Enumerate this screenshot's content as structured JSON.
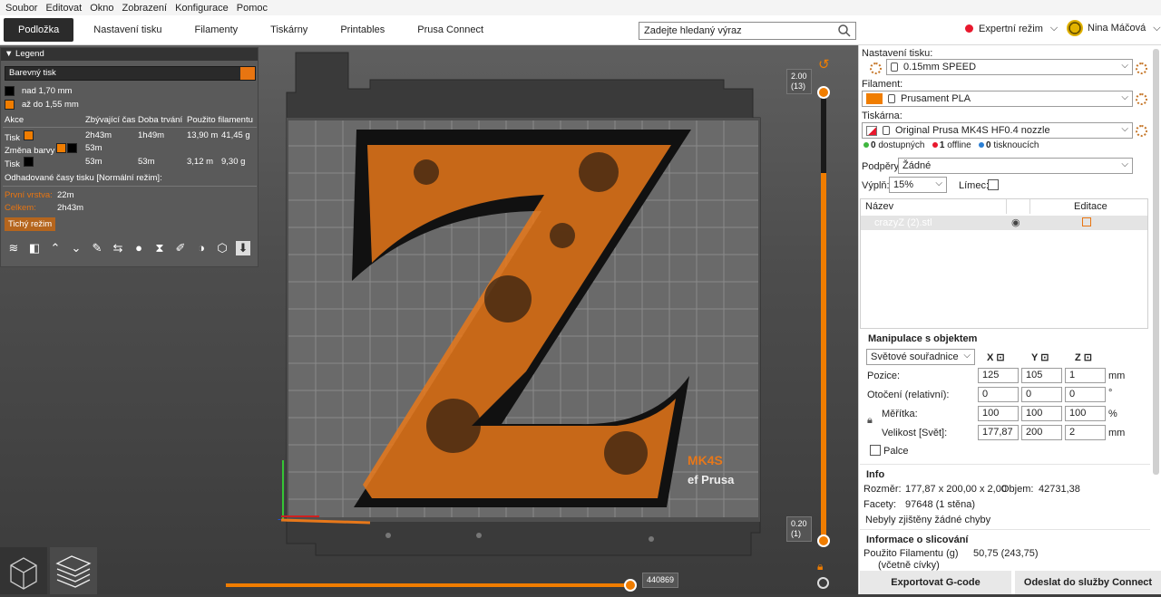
{
  "menu": {
    "items": [
      "Soubor",
      "Editovat",
      "Okno",
      "Zobrazení",
      "Konfigurace",
      "Pomoc"
    ]
  },
  "tabs": [
    "Podložka",
    "Nastavení tisku",
    "Filamenty",
    "Tiskárny",
    "Printables",
    "Prusa Connect"
  ],
  "search": {
    "placeholder": "Zadejte hledaný výraz"
  },
  "mode": {
    "label": "Expertní režim"
  },
  "user": {
    "name": "Nina Máčová"
  },
  "legend": {
    "title": "Legend",
    "view_mode": "Barevný tisk",
    "items": [
      {
        "label": "nad 1,70 mm",
        "color": "#000000"
      },
      {
        "label": "až do 1,55 mm",
        "color": "#f07d00"
      }
    ],
    "columns": [
      "Akce",
      "Zbývající čas",
      "Doba trvání",
      "Použito filamentu"
    ],
    "rows": [
      {
        "action": "Tisk",
        "remaining": "2h43m",
        "duration": "1h49m",
        "length": "13,90 m",
        "weight": "41,45 g"
      },
      {
        "action": "Změna barvy",
        "remaining": "53m",
        "duration": "",
        "length": "",
        "weight": ""
      },
      {
        "action": "Tisk",
        "remaining": "53m",
        "duration": "53m",
        "length": "3,12 m",
        "weight": "9,30 g"
      }
    ],
    "estimated_header": "Odhadované časy tisku [Normální režim]:",
    "first_layer_label": "První vrstva:",
    "first_layer_value": "22m",
    "total_label": "Celkem:",
    "total_value": "2h43m",
    "quiet_mode": "Tichý režim"
  },
  "printbed": {
    "brand_text": "MK4S",
    "brand_sub": "ef Prusa"
  },
  "vertical_slider": {
    "top_value": "2.00",
    "top_layer": "(13)",
    "bottom_value": "0.20",
    "bottom_layer": "(1)"
  },
  "horizontal_slider": {
    "value": "440869"
  },
  "right": {
    "print_settings_label": "Nastavení tisku:",
    "print_profile": "0.15mm SPEED",
    "filament_label": "Filament:",
    "filament_profile": "Prusament PLA",
    "printer_label": "Tiskárna:",
    "printer_profile": "Original Prusa MK4S HF0.4 nozzle",
    "status": [
      {
        "count": "0",
        "text": "dostupných",
        "color": "#3fb63f"
      },
      {
        "count": "1",
        "text": "offline",
        "color": "#e8182d"
      },
      {
        "count": "0",
        "text": "tisknoucích",
        "color": "#2b7fd4"
      }
    ],
    "supports_label": "Podpěry:",
    "supports_value": "Žádné",
    "infill_label": "Výplň:",
    "infill_value": "15%",
    "brim_label": "Límec:",
    "table_headers": [
      "Název",
      "Editace"
    ],
    "object_name": "crazyZ (2).stl",
    "manip_title": "Manipulace s objektem",
    "coord_system": "Světové souřadnice",
    "axes": [
      "X",
      "Y",
      "Z"
    ],
    "position_label": "Pozice:",
    "position": [
      "125",
      "105",
      "1"
    ],
    "position_unit": "mm",
    "rotation_label": "Otočení (relativní):",
    "rotation": [
      "0",
      "0",
      "0"
    ],
    "rotation_unit": "°",
    "scale_label": "Měřítka:",
    "scale": [
      "100",
      "100",
      "100"
    ],
    "scale_unit": "%",
    "size_label": "Velikost [Svět]:",
    "size": [
      "177,87",
      "200",
      "2"
    ],
    "size_unit": "mm",
    "inches_label": "Palce",
    "info_title": "Info",
    "dim_label": "Rozměr:",
    "dim_value": "177,87 x 200,00 x 2,00",
    "volume_label": "Objem:",
    "volume_value": "42731,38",
    "facets_label": "Facety:",
    "facets_value": "97648 (1 stěna)",
    "errors_text": "Nebyly zjištěny žádné chyby",
    "slicing_title": "Informace o slicování",
    "filament_used_label": "Použito Filamentu (g)",
    "filament_used_value": "50,75 (243,75)",
    "filament_used_sub": "(včetně cívky)",
    "export_button": "Exportovat G-code",
    "send_button": "Odeslat do služby Connect"
  },
  "colors": {
    "accent": "#f07d00",
    "dark": "#2b2b2b"
  }
}
